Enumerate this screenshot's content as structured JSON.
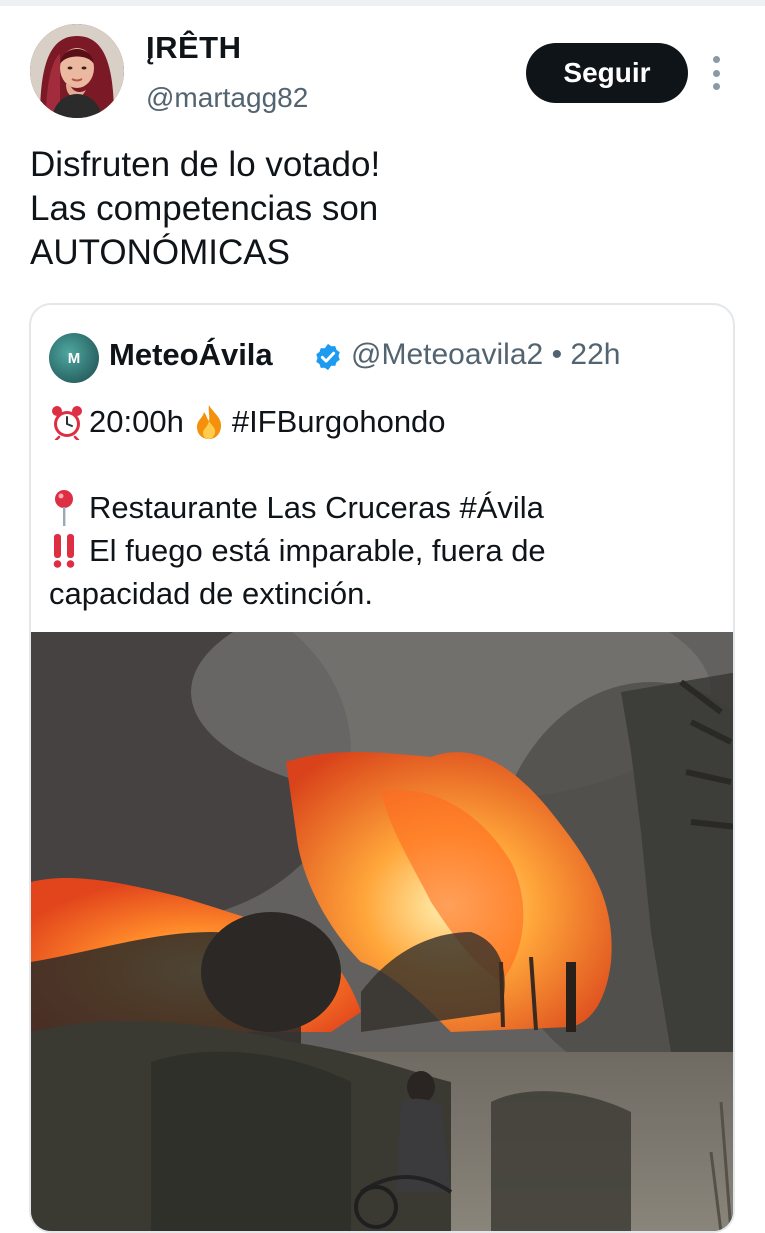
{
  "author": {
    "display_name": "ĮRÊTH",
    "handle": "@martagg82",
    "avatar_icon": "user-avatar"
  },
  "follow_button": {
    "label": "Seguir"
  },
  "more_icon": "more-vertical-icon",
  "tweet": {
    "lines": [
      "Disfruten de lo votado!",
      "Las competencias son",
      "AUTONÓMICAS"
    ]
  },
  "quoted": {
    "name": "MeteoÁvila",
    "avatar_letter": "M",
    "verified": true,
    "handle": "@Meteoavila2",
    "separator": "•",
    "time": "22h",
    "line1": {
      "icon": "alarm-clock-icon",
      "time": "20:00h",
      "icon2": "fire-icon",
      "hashtag": "#IFBurgohondo"
    },
    "line2": {
      "icon": "round-pushpin-icon",
      "text": "Restaurante Las Cruceras #Ávila"
    },
    "line3": {
      "icon": "double-exclamation-icon",
      "text": "El fuego está imparable, fuera de"
    },
    "line4": {
      "text": "capacidad de extinción."
    },
    "media": {
      "type": "video-thumbnail",
      "description_icon": "wildfire-image"
    }
  },
  "colors": {
    "text": "#0f1419",
    "secondary": "#536471",
    "verified": "#1d9bf0",
    "button_bg": "#0f1419",
    "border": "#e3e7ea"
  }
}
